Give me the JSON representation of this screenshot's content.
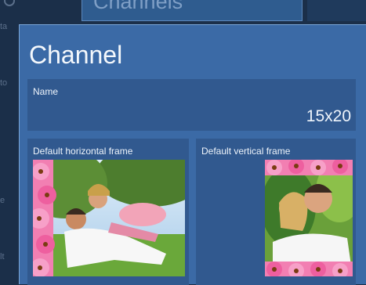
{
  "background": {
    "header_title": "Channels",
    "side_fragments": [
      "ta",
      "to",
      "e",
      "lt"
    ]
  },
  "dialog": {
    "title": "Channel",
    "name_field": {
      "label": "Name",
      "value": "15x20"
    },
    "horizontal_frame": {
      "label": "Default horizontal frame",
      "image": "horizontal-frame-photo"
    },
    "vertical_frame": {
      "label": "Default vertical frame",
      "image": "vertical-frame-photo"
    }
  },
  "colors": {
    "dialog_background": "#3b6aa6",
    "field_background": "#31598f",
    "page_background": "#1b2f49",
    "frame_flowers": "#f06aa8"
  }
}
